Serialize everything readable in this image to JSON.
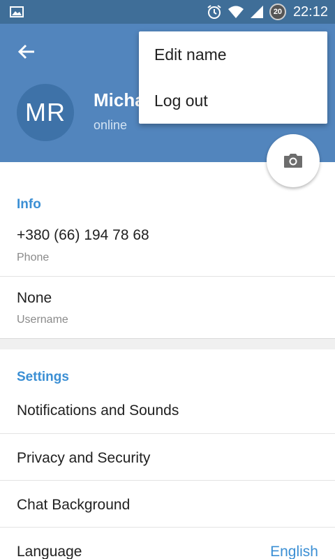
{
  "status_bar": {
    "time": "22:12",
    "battery_level": "20",
    "icons": [
      "image-icon",
      "alarm-icon",
      "wifi-icon",
      "signal-icon"
    ]
  },
  "header": {
    "avatar_initials": "MR",
    "name": "Micha",
    "status": "online",
    "background": "#5285bd"
  },
  "menu": {
    "items": [
      {
        "label": "Edit name"
      },
      {
        "label": "Log out"
      }
    ]
  },
  "info": {
    "title": "Info",
    "phone": {
      "value": "+380 (66) 194 78 68",
      "label": "Phone"
    },
    "username": {
      "value": "None",
      "label": "Username"
    }
  },
  "settings": {
    "title": "Settings",
    "items": [
      {
        "label": "Notifications and Sounds"
      },
      {
        "label": "Privacy and Security"
      },
      {
        "label": "Chat Background"
      },
      {
        "label": "Language",
        "value": "English"
      }
    ]
  },
  "colors": {
    "accent": "#3b8fd4",
    "header": "#5285bd",
    "status_bar": "#3f6e98"
  }
}
